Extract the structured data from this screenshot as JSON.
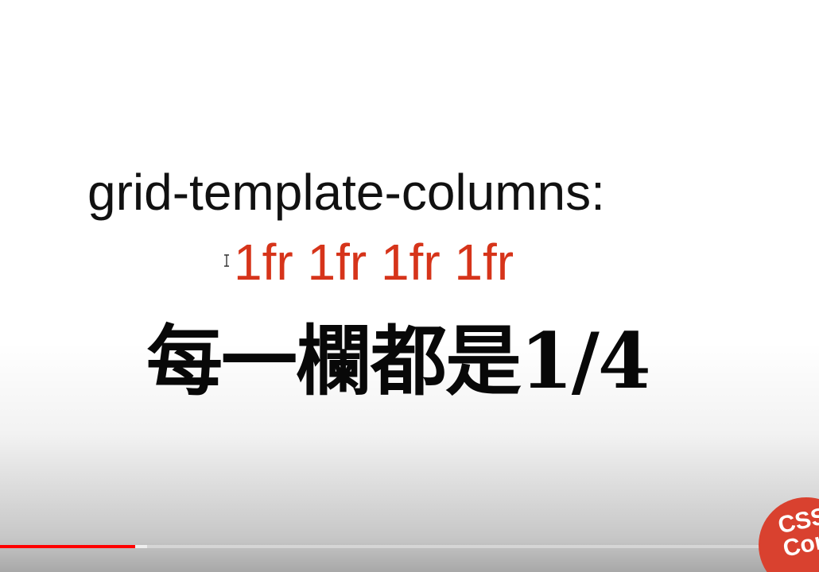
{
  "slide": {
    "line1": "grid-template-columns:",
    "line2": "1fr 1fr 1fr 1fr",
    "line3": "每一欄都是1/4",
    "accent_color": "#d6341a"
  },
  "cursor": {
    "icon": "text-cursor-icon"
  },
  "player": {
    "progress_fraction": 0.165,
    "buffered_fraction": 0.18,
    "progress_color": "#ff0000"
  },
  "channel_badge": {
    "text_line1": "CSS",
    "text_line2": "Con",
    "color": "#d9412f"
  }
}
